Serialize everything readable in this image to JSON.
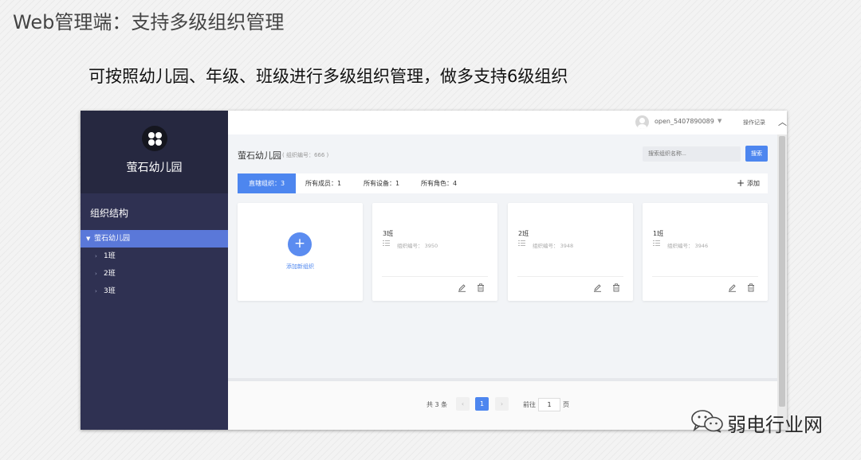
{
  "slide": {
    "title": "Web管理端：支持多级组织管理",
    "subtitle": "可按照幼儿园、年级、班级进行多级组织管理，做多支持6级组织"
  },
  "sidebar": {
    "brand": "萤石幼儿园",
    "section_title": "组织结构",
    "tree": [
      {
        "label": "萤石幼儿园"
      },
      {
        "label": "1班"
      },
      {
        "label": "2班"
      },
      {
        "label": "3班"
      }
    ]
  },
  "topbar": {
    "username": "open_5407890089",
    "op_log": "操作记录"
  },
  "main": {
    "org_name": "萤石幼儿园",
    "org_code": "( 组织编号：666 )",
    "search_placeholder": "搜索组织名称...",
    "search_button": "搜索",
    "tabs": [
      "直辖组织：3",
      "所有成员：1",
      "所有设备：1",
      "所有角色：4"
    ],
    "add_label": "添加",
    "new_org_label": "添加新组织",
    "cards": [
      {
        "name": "3班",
        "code": "组织编号：  3950"
      },
      {
        "name": "2班",
        "code": "组织编号：  3948"
      },
      {
        "name": "1班",
        "code": "组织编号：  3946"
      }
    ]
  },
  "pagination": {
    "total": "共 3 条",
    "prev": "‹",
    "current": "1",
    "next": "›",
    "goto": "前往",
    "goto_value": "1",
    "page_unit": "页"
  },
  "watermark": {
    "text": "弱电行业网"
  },
  "colors": {
    "accent": "#4d86ef",
    "sidebar": "#2f3152",
    "sidebar_active": "#5a78d9"
  }
}
